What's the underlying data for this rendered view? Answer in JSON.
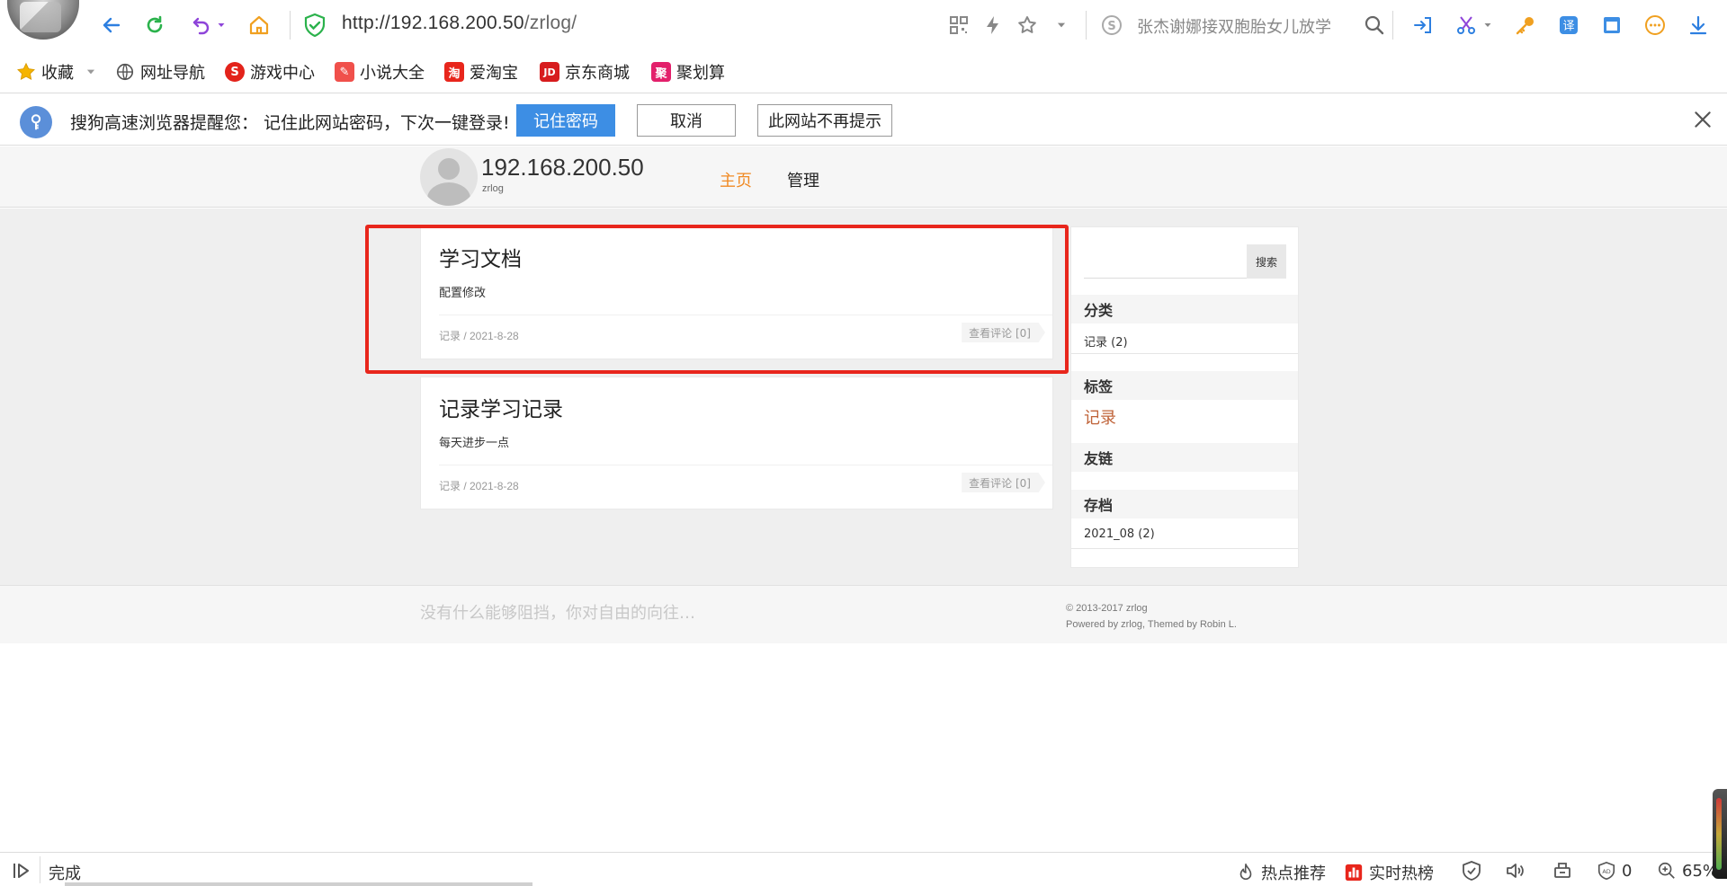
{
  "browser": {
    "url_host": "http://192.168.200.50",
    "url_path": "/zrlog/",
    "search_hint": "张杰谢娜接双胞胎女儿放学",
    "status_text": "完成",
    "hot_recommend": "热点推荐",
    "realtime_hot": "实时热榜",
    "ad_block_count": "0",
    "zoom": "65%"
  },
  "bookmarks": [
    {
      "label": "收藏",
      "icon": "star-icon"
    },
    {
      "label": "网址导航",
      "icon": "globe-icon"
    },
    {
      "label": "游戏中心",
      "icon": "game-icon"
    },
    {
      "label": "小说大全",
      "icon": "book-icon"
    },
    {
      "label": "爱淘宝",
      "icon": "taobao-icon"
    },
    {
      "label": "京东商城",
      "icon": "jd-icon"
    },
    {
      "label": "聚划算",
      "icon": "juhuasuan-icon"
    }
  ],
  "notify": {
    "message": "搜狗高速浏览器提醒您：  记住此网站密码，下次一键登录!",
    "remember": "记住密码",
    "cancel": "取消",
    "never": "此网站不再提示"
  },
  "site": {
    "title": "192.168.200.50",
    "subtitle": "zrlog",
    "nav": [
      "主页",
      "管理"
    ]
  },
  "posts": [
    {
      "title": "学习文档",
      "summary": "配置修改",
      "meta": "记录 / 2021-8-28",
      "comments": "查看评论 [0]"
    },
    {
      "title": "记录学习记录",
      "summary": "每天进步一点",
      "meta": "记录 / 2021-8-28",
      "comments": "查看评论 [0]"
    }
  ],
  "sidebar": {
    "search_button": "搜索",
    "category_title": "分类",
    "category_item": "记录 (2)",
    "tag_title": "标签",
    "tag_item": "记录",
    "links_title": "友链",
    "archive_title": "存档",
    "archive_item": "2021_08 (2)"
  },
  "footer": {
    "motto": "没有什么能够阻挡，你对自由的向往…",
    "copyright": "© 2013-2017 zrlog",
    "powered": "Powered by zrlog, Themed by Robin L."
  },
  "colors": {
    "nav_active": "#f08a24",
    "highlight": "#e8261c",
    "primary_button": "#3d8ee4",
    "tag": "#c0643a"
  }
}
